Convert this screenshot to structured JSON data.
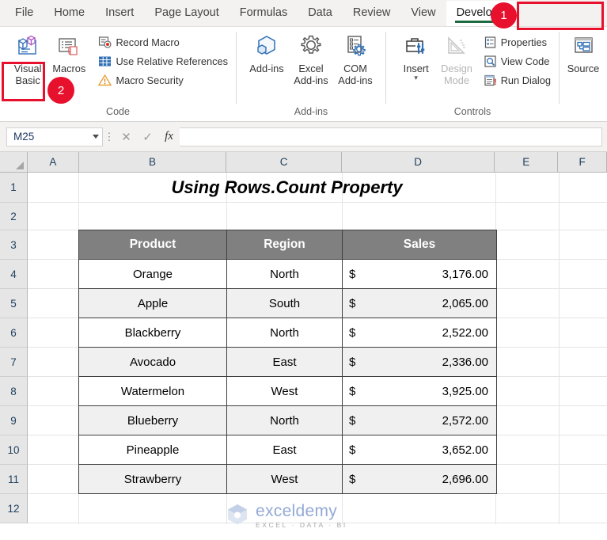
{
  "ribbon": {
    "tabs": [
      {
        "label": "File",
        "active": false
      },
      {
        "label": "Home",
        "active": false
      },
      {
        "label": "Insert",
        "active": false
      },
      {
        "label": "Page Layout",
        "active": false
      },
      {
        "label": "Formulas",
        "active": false
      },
      {
        "label": "Data",
        "active": false
      },
      {
        "label": "Review",
        "active": false
      },
      {
        "label": "View",
        "active": false
      },
      {
        "label": "Developer",
        "active": true
      }
    ],
    "groups": {
      "code": {
        "label": "Code",
        "visual_basic": "Visual Basic",
        "macros": "Macros",
        "record_macro": "Record Macro",
        "use_relative_references": "Use Relative References",
        "macro_security": "Macro Security"
      },
      "addins": {
        "label": "Add-ins",
        "addins": "Add-ins",
        "excel_addins": "Excel Add-ins",
        "com_addins": "COM Add-ins"
      },
      "controls": {
        "label": "Controls",
        "insert": "Insert",
        "design_mode": "Design Mode",
        "properties": "Properties",
        "view_code": "View Code",
        "run_dialog": "Run Dialog"
      },
      "xml": {
        "source": "Source"
      }
    }
  },
  "formula_bar": {
    "name_box_value": "M25",
    "cancel_glyph": "✕",
    "enter_glyph": "✓",
    "fx_label": "fx",
    "formula_value": ""
  },
  "grid": {
    "columns": [
      "A",
      "B",
      "C",
      "D",
      "E",
      "F"
    ],
    "rows": [
      "1",
      "2",
      "3",
      "4",
      "5",
      "6",
      "7",
      "8",
      "9",
      "10",
      "11",
      "12"
    ],
    "title": "Using Rows.Count Property"
  },
  "table": {
    "headers": [
      "Product",
      "Region",
      "Sales"
    ],
    "currency_symbol": "$",
    "rows": [
      {
        "product": "Orange",
        "region": "North",
        "sales": "3,176.00"
      },
      {
        "product": "Apple",
        "region": "South",
        "sales": "2,065.00"
      },
      {
        "product": "Blackberry",
        "region": "North",
        "sales": "2,522.00"
      },
      {
        "product": "Avocado",
        "region": "East",
        "sales": "2,336.00"
      },
      {
        "product": "Watermelon",
        "region": "West",
        "sales": "3,925.00"
      },
      {
        "product": "Blueberry",
        "region": "North",
        "sales": "2,572.00"
      },
      {
        "product": "Pineapple",
        "region": "East",
        "sales": "3,652.00"
      },
      {
        "product": "Strawberry",
        "region": "West",
        "sales": "2,696.00"
      }
    ]
  },
  "watermark": {
    "main": "exceldemy",
    "sub": "EXCEL · DATA · BI"
  },
  "annotations": {
    "badge_1": "1",
    "badge_2": "2",
    "accent_color": "#e8112d"
  }
}
